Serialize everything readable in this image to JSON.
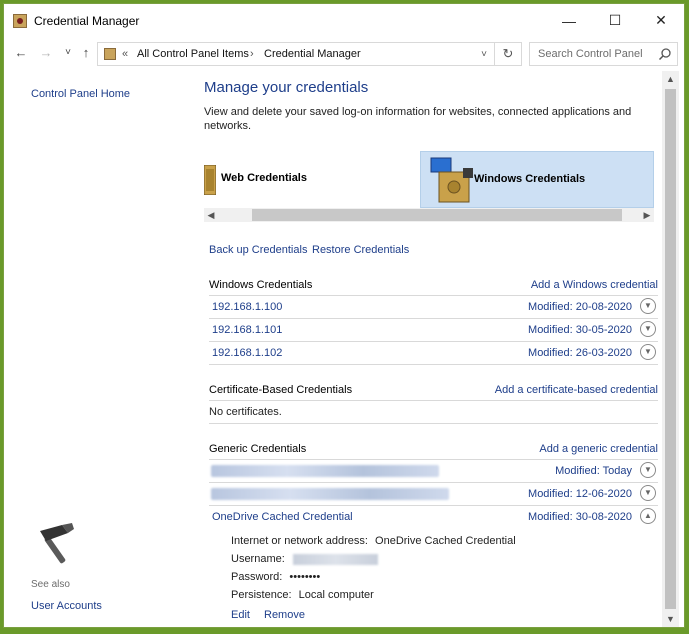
{
  "window": {
    "title": "Credential Manager"
  },
  "titlebar": {
    "minimize": "—",
    "maximize": "☐",
    "close": "✕"
  },
  "nav": {
    "back": "←",
    "forward": "→",
    "recent": "˅",
    "up": "↑"
  },
  "address": {
    "overflow": "«",
    "crumb1": "All Control Panel Items",
    "sep": "›",
    "crumb2": "Credential Manager",
    "dropdown": "˅",
    "refresh": "↻"
  },
  "search": {
    "placeholder": "Search Control Panel"
  },
  "sidebar": {
    "home": "Control Panel Home",
    "see_also": "See also",
    "user_accounts": "User Accounts"
  },
  "main": {
    "heading": "Manage your credentials",
    "description": "View and delete your saved log-on information for websites, connected applications and networks.",
    "tabs": [
      {
        "label": "Web Credentials",
        "selected": false
      },
      {
        "label": "Windows Credentials",
        "selected": true
      }
    ],
    "backup_link": "Back up Credentials",
    "restore_link": "Restore Credentials",
    "windows_section": {
      "title": "Windows Credentials",
      "add": "Add a Windows credential",
      "items": [
        {
          "name": "192.168.1.100",
          "modified": "Modified:  20-08-2020"
        },
        {
          "name": "192.168.1.101",
          "modified": "Modified:  30-05-2020"
        },
        {
          "name": "192.168.1.102",
          "modified": "Modified:  26-03-2020"
        }
      ]
    },
    "certificate_section": {
      "title": "Certificate-Based Credentials",
      "add": "Add a certificate-based credential",
      "empty": "No certificates."
    },
    "generic_section": {
      "title": "Generic Credentials",
      "add": "Add a generic credential",
      "items": [
        {
          "modified": "Modified:  Today"
        },
        {
          "modified": "Modified:  12-06-2020"
        },
        {
          "name": "OneDrive Cached Credential",
          "modified": "Modified:  30-08-2020"
        }
      ],
      "expanded": {
        "address_label": "Internet or network address:",
        "address_value": "OneDrive Cached Credential",
        "username_label": "Username:",
        "password_label": "Password:",
        "password_value": "••••••••",
        "persistence_label": "Persistence:",
        "persistence_value": "Local computer",
        "edit": "Edit",
        "remove": "Remove"
      }
    }
  },
  "colors": {
    "link": "#1e3e8a",
    "selected_tab": "#cde0f4",
    "desktop": "#6a9a2a"
  }
}
